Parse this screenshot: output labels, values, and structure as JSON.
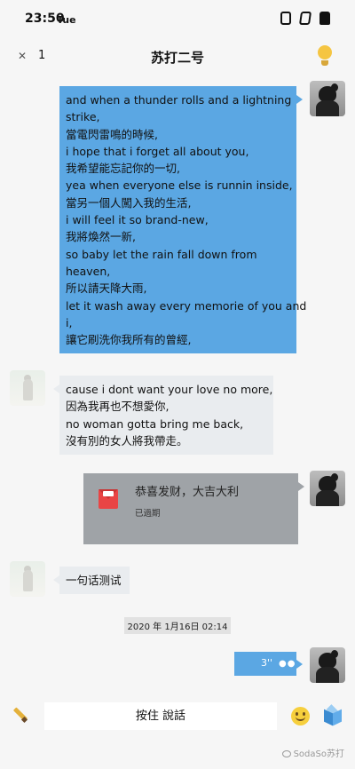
{
  "status_bar": {
    "time": "23:50",
    "day": "Tue"
  },
  "nav": {
    "back_icon": "close-x",
    "count": "1",
    "title": "苏打二号"
  },
  "messages": [
    {
      "sender": "me",
      "lines": [
        "and when a thunder rolls and a lightning",
        "strike,",
        "當電閃雷鳴的時候,",
        "i hope that i forget all about you,",
        "我希望能忘記你的一切,",
        "yea when everyone else is runnin inside,",
        "當另一個人闖入我的生活,",
        "i will feel it so brand-new,",
        "我將煥然一新,",
        "so baby let the rain fall down from",
        "heaven,",
        "所以請天降大雨,",
        "let it wash away every memorie of you and",
        "i,",
        "讓它刷洗你我所有的曾經,"
      ]
    },
    {
      "sender": "other",
      "lines": [
        "cause i dont want your love no more,",
        "因為我再也不想愛你,",
        "no woman gotta bring me back,",
        "沒有別的女人將我帶走。"
      ]
    },
    {
      "sender": "other",
      "lines": [
        "一句话测试"
      ]
    }
  ],
  "red_packet": {
    "title": "恭喜发财，大吉大利",
    "status": "已過期"
  },
  "timestamp": "2020 年 1月16日 02:14",
  "voice_message": {
    "duration": "3''"
  },
  "input_bar": {
    "hold_to_talk": "按住 說話"
  },
  "watermark": "SodaSo苏打",
  "colors": {
    "my_bubble": "#5ba7e3",
    "other_bubble": "#e9ecef",
    "packet": "#9fa3a7"
  }
}
